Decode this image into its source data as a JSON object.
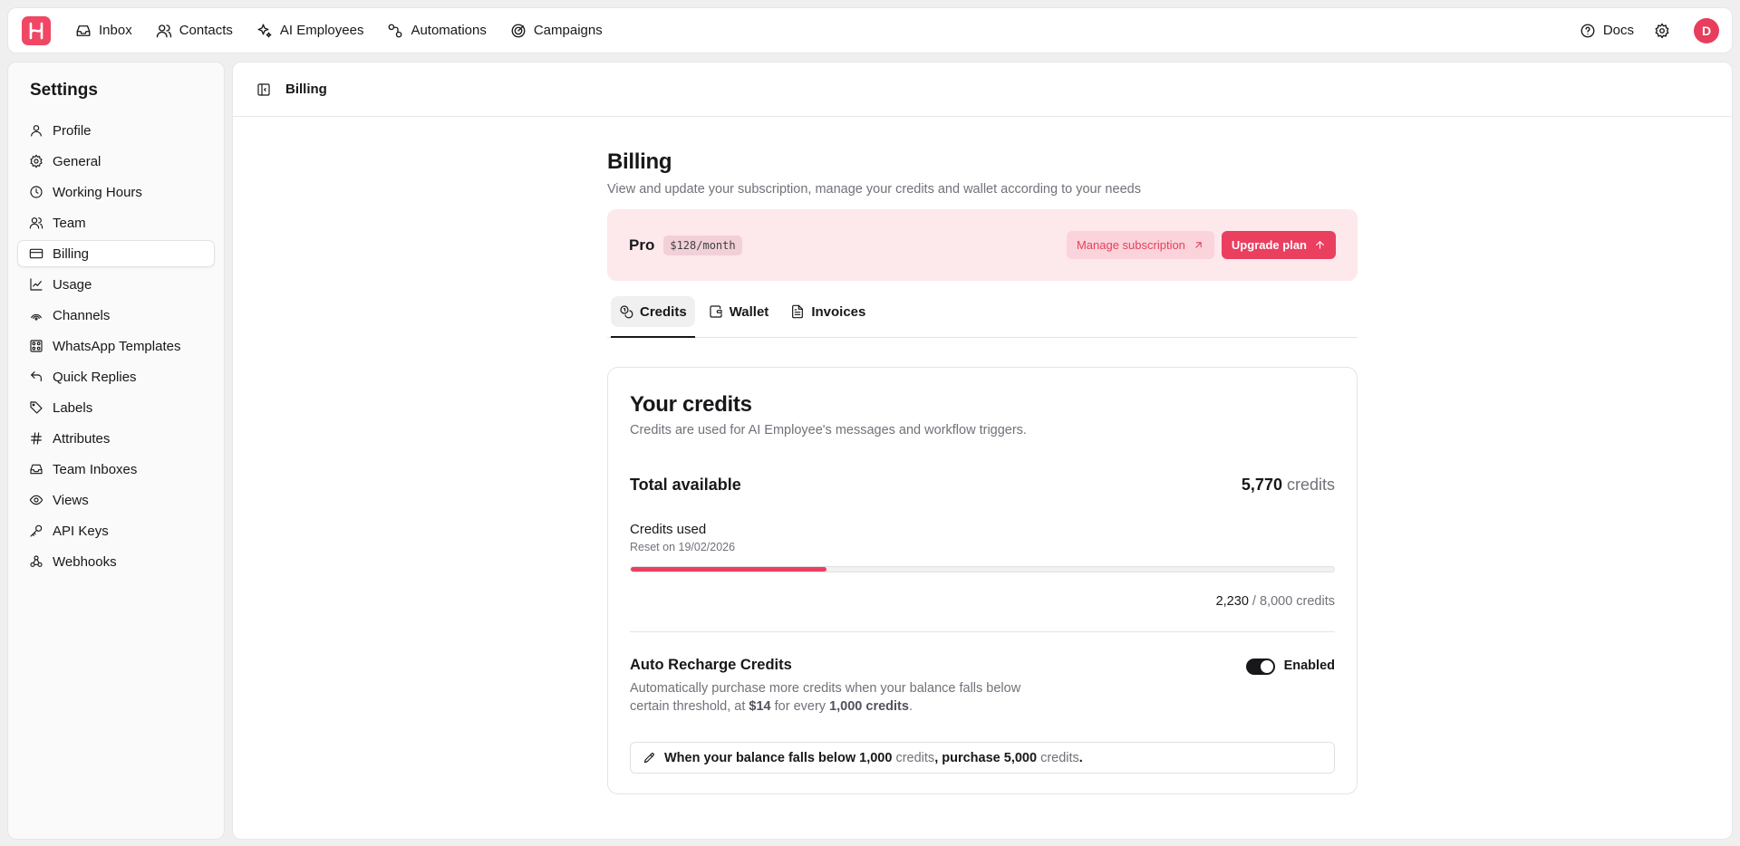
{
  "topnav": {
    "items": [
      {
        "label": "Inbox",
        "icon": "inbox-icon"
      },
      {
        "label": "Contacts",
        "icon": "contacts-icon"
      },
      {
        "label": "AI Employees",
        "icon": "sparkles-icon"
      },
      {
        "label": "Automations",
        "icon": "workflow-icon"
      },
      {
        "label": "Campaigns",
        "icon": "target-icon"
      }
    ],
    "docs_label": "Docs",
    "avatar_initial": "D",
    "brand_color": "#ef4764"
  },
  "sidebar": {
    "title": "Settings",
    "items": [
      {
        "label": "Profile",
        "icon": "user-icon"
      },
      {
        "label": "General",
        "icon": "gear-icon"
      },
      {
        "label": "Working Hours",
        "icon": "clock-icon"
      },
      {
        "label": "Team",
        "icon": "users-icon"
      },
      {
        "label": "Billing",
        "icon": "credit-card-icon",
        "active": true
      },
      {
        "label": "Usage",
        "icon": "chart-icon"
      },
      {
        "label": "Channels",
        "icon": "broadcast-icon"
      },
      {
        "label": "WhatsApp Templates",
        "icon": "template-icon"
      },
      {
        "label": "Quick Replies",
        "icon": "reply-icon"
      },
      {
        "label": "Labels",
        "icon": "tag-icon"
      },
      {
        "label": "Attributes",
        "icon": "hash-icon"
      },
      {
        "label": "Team Inboxes",
        "icon": "inbox-icon"
      },
      {
        "label": "Views",
        "icon": "eye-icon"
      },
      {
        "label": "API Keys",
        "icon": "key-icon"
      },
      {
        "label": "Webhooks",
        "icon": "webhook-icon"
      }
    ]
  },
  "header": {
    "breadcrumb": "Billing"
  },
  "billing": {
    "title": "Billing",
    "subtitle": "View and update your subscription, manage your credits and wallet according to your needs",
    "plan": {
      "name": "Pro",
      "price": "$128/month",
      "manage_label": "Manage subscription",
      "upgrade_label": "Upgrade plan"
    },
    "tabs": [
      {
        "label": "Credits",
        "icon": "coins-icon",
        "active": true
      },
      {
        "label": "Wallet",
        "icon": "wallet-icon"
      },
      {
        "label": "Invoices",
        "icon": "file-icon"
      }
    ],
    "credits": {
      "title": "Your credits",
      "subtitle": "Credits are used for AI Employee's messages and workflow triggers.",
      "total_label": "Total available",
      "total_value": "5,770",
      "total_unit": "credits",
      "used_label": "Credits used",
      "reset_text": "Reset on 19/02/2026",
      "used_value": "2,230",
      "used_limit": "/ 8,000 credits",
      "used_fraction": 0.27875,
      "progress_color": "#ec3f5f"
    },
    "auto_recharge": {
      "title": "Auto Recharge Credits",
      "desc_part1": "Automatically purchase more credits when your balance falls below certain threshold, at ",
      "price": "$14",
      "desc_part2": " for every ",
      "per_amount": "1,000 credits",
      "desc_part3": ".",
      "toggle_label": "Enabled",
      "enabled": true,
      "rule": {
        "part1": "When your balance falls below",
        "threshold": "1,000",
        "unit1": "credits",
        "part2": ", purchase",
        "amount": "5,000",
        "unit2": "credits",
        "end": "."
      }
    }
  }
}
